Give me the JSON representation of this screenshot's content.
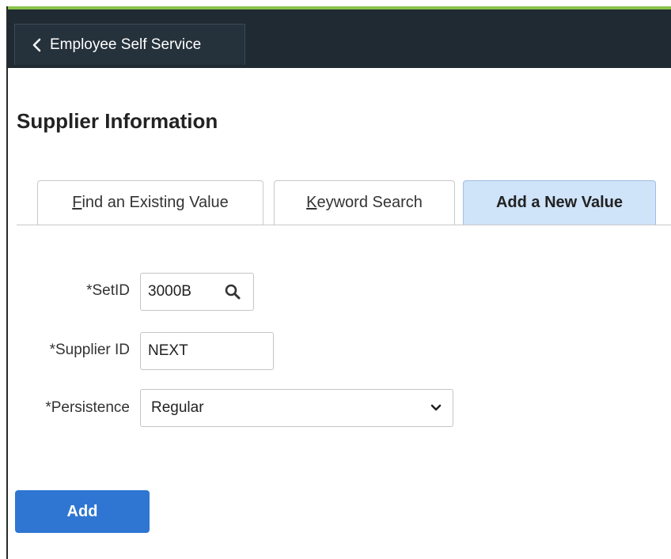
{
  "header": {
    "back_label": "Employee Self Service"
  },
  "page": {
    "title": "Supplier Information"
  },
  "tabs": [
    {
      "first_letter": "F",
      "rest": "ind an Existing Value",
      "active": false
    },
    {
      "first_letter": "K",
      "rest": "eyword Search",
      "active": false
    },
    {
      "label": "Add a New Value",
      "active": true
    }
  ],
  "form": {
    "setid": {
      "label": "*SetID",
      "value": "3000B"
    },
    "supplier_id": {
      "label": "*Supplier ID",
      "value": "NEXT"
    },
    "persistence": {
      "label": "*Persistence",
      "value": "Regular"
    }
  },
  "actions": {
    "add_label": "Add"
  },
  "colors": {
    "topbar": "#1f2a33",
    "accent_strip": "#8bc34a",
    "active_tab": "#cfe3f9",
    "primary_button": "#2f76d2"
  },
  "icons": {
    "back": "chevron-left-icon",
    "lookup": "search-icon",
    "dropdown": "chevron-down-icon"
  }
}
